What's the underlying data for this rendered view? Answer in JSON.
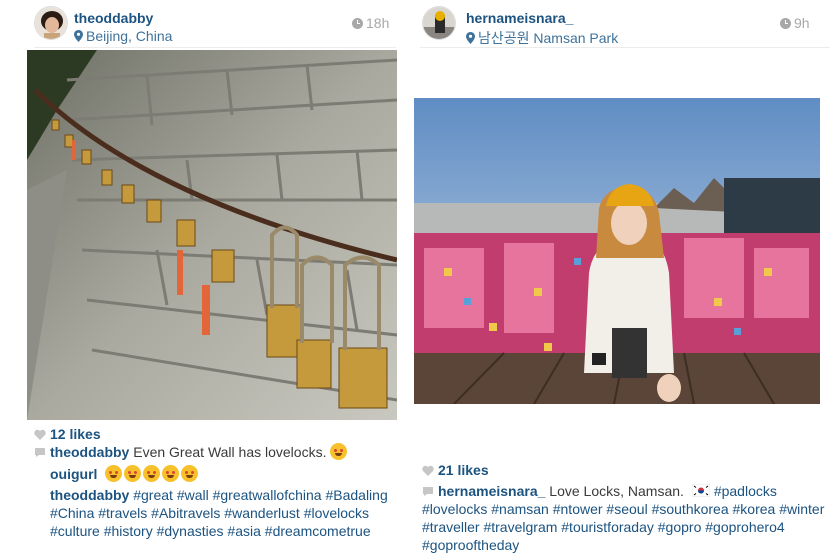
{
  "posts": [
    {
      "username": "theoddabby",
      "location": "Beijing, China",
      "time": "18h",
      "likes": "12 likes",
      "caption_user": "theoddabby",
      "caption_text": "Even Great Wall has lovelocks.",
      "comment_user": "ouigurl",
      "comment_emoji_count": 5,
      "tags_user": "theoddabby",
      "tags": "#great #wall #greatwallofchina #Badaling #China #travels #Abitravels #wanderlust #lovelocks #culture #history #dynasties #asia #dreamcometrue"
    },
    {
      "username": "hernameisnara_",
      "location": "남산공원 Namsan Park",
      "time": "9h",
      "likes": "21 likes",
      "caption_user": "hernameisnara_",
      "caption_text": "Love Locks, Namsan.",
      "tags": "#padlocks #lovelocks #namsan #ntower #seoul #southkorea #korea #winter #traveller #travelgram #touristforaday #gopro #goprohero4 #goprooftheday"
    }
  ],
  "colors": {
    "link": "#1c5380",
    "location": "#3f729b",
    "muted": "#a8a8a8"
  },
  "icons": [
    "clock-icon",
    "location-pin-icon",
    "heart-icon",
    "comment-bubble-icon",
    "smiling-face-emoji",
    "korean-flag-emoji"
  ]
}
